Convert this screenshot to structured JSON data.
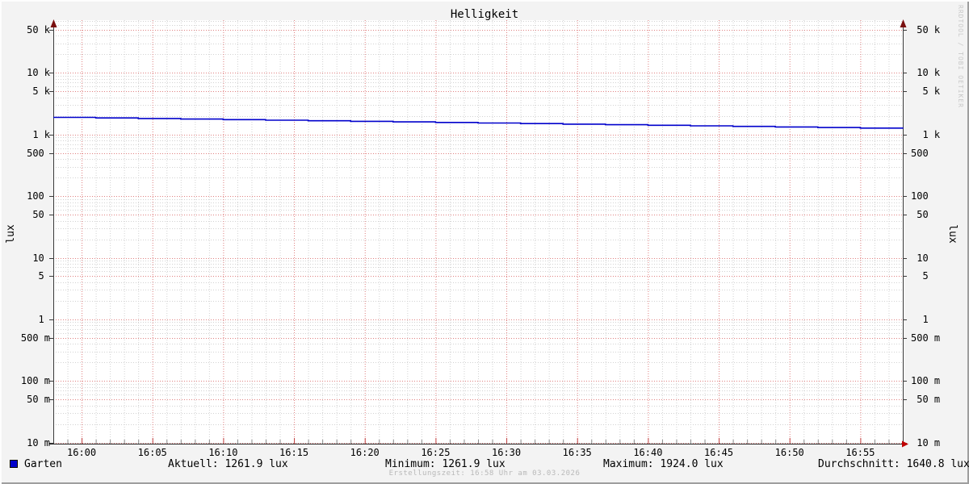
{
  "title": "Helligkeit",
  "watermark": "RRDTOOL / TOBI OETIKER",
  "footer": "Erstellungszeit: 16:58 Uhr am 03.03.2026",
  "y_axis": {
    "unit": "lux",
    "ticks": [
      {
        "v": 50000,
        "label": " 50 k"
      },
      {
        "v": 10000,
        "label": " 10 k"
      },
      {
        "v": 5000,
        "label": "  5 k"
      },
      {
        "v": 1000,
        "label": "  1 k"
      },
      {
        "v": 500,
        "label": "500 "
      },
      {
        "v": 100,
        "label": "100 "
      },
      {
        "v": 50,
        "label": " 50 "
      },
      {
        "v": 10,
        "label": " 10 "
      },
      {
        "v": 5,
        "label": "  5 "
      },
      {
        "v": 1,
        "label": "  1 "
      },
      {
        "v": 0.5,
        "label": "500 m"
      },
      {
        "v": 0.1,
        "label": "100 m"
      },
      {
        "v": 0.05,
        "label": " 50 m"
      },
      {
        "v": 0.01,
        "label": " 10 m"
      }
    ]
  },
  "x_axis": {
    "ticks": [
      "16:00",
      "16:05",
      "16:10",
      "16:15",
      "16:20",
      "16:25",
      "16:30",
      "16:35",
      "16:40",
      "16:45",
      "16:50",
      "16:55"
    ]
  },
  "legend": {
    "series_label": "Garten",
    "series_color": "#0000cc",
    "stats": [
      {
        "text": "Aktuell: 1261.9 lux"
      },
      {
        "text": "Minimum: 1261.9 lux"
      },
      {
        "text": "Maximum: 1924.0 lux"
      },
      {
        "text": "Durchschnitt: 1640.8 lux"
      }
    ]
  },
  "colors": {
    "background": "#f3f3f3",
    "canvas": "#ffffff",
    "grid_major": "#e08080",
    "grid_minor": "#d2d2d2",
    "axis": "#3a3a3a",
    "arrow_y": "#7a1010",
    "arrow_x": "#c00000",
    "line": "#0000cc",
    "muted_text": "#b9b9b9"
  },
  "chart_data": {
    "type": "line",
    "title": "Helligkeit",
    "xlabel": "",
    "ylabel": "lux",
    "y_scale": "log",
    "ylim": [
      0.01,
      70000
    ],
    "x_range": [
      "15:58",
      "16:58"
    ],
    "x_grid_minutes": {
      "minor": 1,
      "major": 5
    },
    "grid": true,
    "legend_position": "bottom",
    "series": [
      {
        "name": "Garten",
        "color": "#0000cc",
        "points": [
          [
            "15:58",
            1924
          ],
          [
            "16:01",
            1884
          ],
          [
            "16:04",
            1845
          ],
          [
            "16:07",
            1806
          ],
          [
            "16:10",
            1769
          ],
          [
            "16:13",
            1732
          ],
          [
            "16:16",
            1696
          ],
          [
            "16:19",
            1660
          ],
          [
            "16:22",
            1626
          ],
          [
            "16:25",
            1592
          ],
          [
            "16:28",
            1559
          ],
          [
            "16:31",
            1526
          ],
          [
            "16:34",
            1494
          ],
          [
            "16:37",
            1463
          ],
          [
            "16:40",
            1432
          ],
          [
            "16:43",
            1402
          ],
          [
            "16:46",
            1373
          ],
          [
            "16:49",
            1344
          ],
          [
            "16:52",
            1316
          ],
          [
            "16:55",
            1289
          ],
          [
            "16:58",
            1262
          ]
        ]
      }
    ],
    "stats": {
      "aktuell_lux": 1261.9,
      "minimum_lux": 1261.9,
      "maximum_lux": 1924.0,
      "durchschnitt_lux": 1640.8
    }
  }
}
